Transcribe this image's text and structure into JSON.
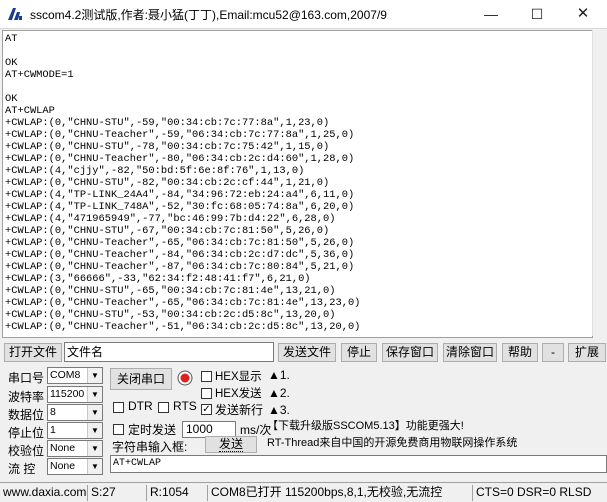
{
  "window": {
    "title": "sscom4.2测试版,作者:聂小猛(丁丁),Email:mcu52@163.com,2007/9",
    "minimize": "—",
    "maximize": "☐",
    "close": "✕"
  },
  "console": {
    "lines": [
      "AT",
      "",
      "OK",
      "AT+CWMODE=1",
      "",
      "OK",
      "AT+CWLAP",
      "+CWLAP:(0,\"CHNU-STU\",-59,\"00:34:cb:7c:77:8a\",1,23,0)",
      "+CWLAP:(0,\"CHNU-Teacher\",-59,\"06:34:cb:7c:77:8a\",1,25,0)",
      "+CWLAP:(0,\"CHNU-STU\",-78,\"00:34:cb:7c:75:42\",1,15,0)",
      "+CWLAP:(0,\"CHNU-Teacher\",-80,\"06:34:cb:2c:d4:60\",1,28,0)",
      "+CWLAP:(4,\"cjjy\",-82,\"50:bd:5f:6e:8f:76\",1,13,0)",
      "+CWLAP:(0,\"CHNU-STU\",-82,\"00:34:cb:2c:cf:44\",1,21,0)",
      "+CWLAP:(4,\"TP-LINK_24A4\",-84,\"34:96:72:eb:24:a4\",6,11,0)",
      "+CWLAP:(4,\"TP-LINK_748A\",-52,\"30:fc:68:05:74:8a\",6,20,0)",
      "+CWLAP:(4,\"471965949\",-77,\"bc:46:99:7b:d4:22\",6,28,0)",
      "+CWLAP:(0,\"CHNU-STU\",-67,\"00:34:cb:7c:81:50\",5,26,0)",
      "+CWLAP:(0,\"CHNU-Teacher\",-65,\"06:34:cb:7c:81:50\",5,26,0)",
      "+CWLAP:(0,\"CHNU-Teacher\",-84,\"06:34:cb:2c:d7:dc\",5,36,0)",
      "+CWLAP:(0,\"CHNU-Teacher\",-87,\"06:34:cb:7c:80:84\",5,21,0)",
      "+CWLAP:(3,\"66666\",-33,\"62:34:f2:48:41:f7\",6,21,0)",
      "+CWLAP:(0,\"CHNU-STU\",-65,\"00:34:cb:7c:81:4e\",13,21,0)",
      "+CWLAP:(0,\"CHNU-Teacher\",-65,\"06:34:cb:7c:81:4e\",13,23,0)",
      "+CWLAP:(0,\"CHNU-STU\",-53,\"00:34:cb:2c:d5:8c\",13,20,0)",
      "+CWLAP:(0,\"CHNU-Teacher\",-51,\"06:34:cb:2c:d5:8c\",13,20,0)"
    ]
  },
  "filebar": {
    "open_file": "打开文件",
    "filename_value": "文件名",
    "send_file": "发送文件",
    "stop": "停止",
    "save_window": "保存窗口",
    "clear_window": "清除窗口",
    "help": "帮助",
    "collapse": "-",
    "expand": "扩展"
  },
  "settings": {
    "port_label": "串口号",
    "port_value": "COM8",
    "baud_label": "波特率",
    "baud_value": "115200",
    "databits_label": "数据位",
    "databits_value": "8",
    "stopbits_label": "停止位",
    "stopbits_value": "1",
    "parity_label": "校验位",
    "parity_value": "None",
    "flow_label": "流 控",
    "flow_value": "None"
  },
  "controls": {
    "close_port": "关闭串口",
    "hex_display": "HEX显示",
    "hex_send": "HEX发送",
    "dtr": "DTR",
    "rts": "RTS",
    "send_newline": "发送新行",
    "timed_send": "定时发送",
    "interval_value": "1000",
    "interval_unit": "ms/次",
    "input_label": "字符串输入框:",
    "send": "发送",
    "send_text": "AT+CWLAP",
    "quick_1": "▲1.",
    "quick_2": "▲2.",
    "quick_3": "▲3."
  },
  "info": {
    "line1": "【下载升级版SSCOM5.13】功能更强大!",
    "line2": "RT-Thread来自中国的开源免费商用物联网操作系统"
  },
  "statusbar": {
    "website": "www.daxia.com",
    "sent": "S:27",
    "received": "R:1054",
    "port_status": "COM8已打开  115200bps,8,1,无校验,无流控",
    "lines_status": "CTS=0 DSR=0 RLSD"
  },
  "colors": {
    "led_red": "#e02020",
    "checkbox_checked": "#000000"
  }
}
